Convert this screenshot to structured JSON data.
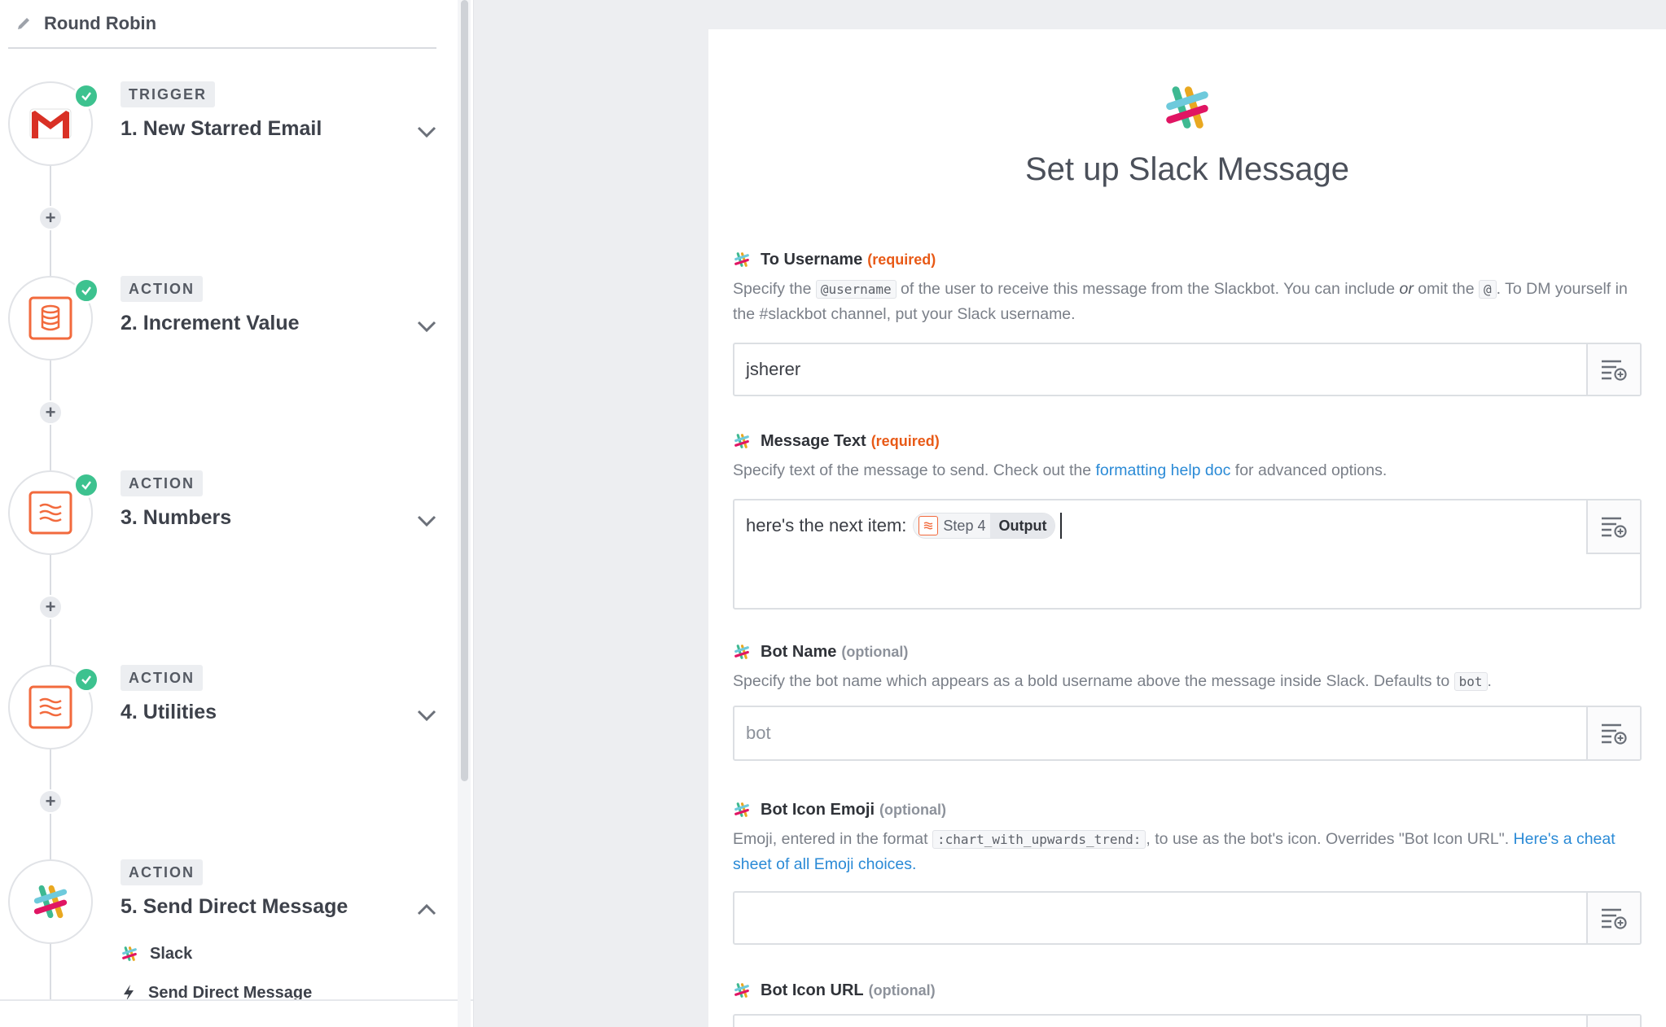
{
  "zap": {
    "title": "Round Robin"
  },
  "steps": [
    {
      "badge": "TRIGGER",
      "title": "1. New Starred Email",
      "app": "gmail",
      "expanded": false
    },
    {
      "badge": "ACTION",
      "title": "2. Increment Value",
      "app": "storage",
      "expanded": false
    },
    {
      "badge": "ACTION",
      "title": "3. Numbers",
      "app": "formatter",
      "expanded": false
    },
    {
      "badge": "ACTION",
      "title": "4. Utilities",
      "app": "formatter",
      "expanded": false
    },
    {
      "badge": "ACTION",
      "title": "5. Send Direct Message",
      "app": "slack",
      "expanded": true
    }
  ],
  "step5_details": {
    "app_label": "Slack",
    "action_label": "Send Direct Message"
  },
  "panel": {
    "title": "Set up Slack Message"
  },
  "fields": {
    "to_username": {
      "label": "To Username",
      "badge": "(required)",
      "help_1": "Specify the",
      "help_code_1": "@username",
      "help_2": "of the user to receive this message from the Slackbot. You can include",
      "help_em": "or",
      "help_3": "omit the",
      "help_code_2": "@",
      "help_4": ". To DM yourself in the #slackbot channel, put your Slack username.",
      "value": "jsherer"
    },
    "message_text": {
      "label": "Message Text",
      "badge": "(required)",
      "help_1": "Specify text of the message to send. Check out the",
      "help_link": "formatting help doc",
      "help_2": "for advanced options.",
      "value_prefix": "here's the next item:",
      "pill_step": "Step 4",
      "pill_output": "Output"
    },
    "bot_name": {
      "label": "Bot Name",
      "badge": "(optional)",
      "help_1": "Specify the bot name which appears as a bold username above the message inside Slack. Defaults to",
      "help_code": "bot",
      "help_2": ".",
      "placeholder": "bot"
    },
    "bot_icon_emoji": {
      "label": "Bot Icon Emoji",
      "badge": "(optional)",
      "help_1": "Emoji, entered in the format",
      "help_code": ":chart_with_upwards_trend:",
      "help_2": ", to use as the bot's icon. Overrides \"Bot Icon URL\".",
      "help_link": "Here's a cheat sheet of all Emoji choices.",
      "value": ""
    },
    "bot_icon_url": {
      "label": "Bot Icon URL",
      "badge": "(optional)"
    }
  },
  "colors": {
    "check": "#3dc28f",
    "required": "#e85a17",
    "link": "#2a8ad6",
    "formatter": "#f26a3d",
    "gmail_red": "#d93025"
  }
}
